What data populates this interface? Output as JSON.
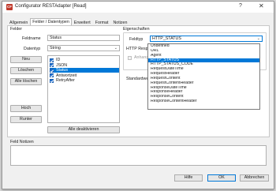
{
  "window": {
    "title": "Configurator RESTAdapter [Read]",
    "icon_label": "CF",
    "help_label": "?",
    "close_label": "✕"
  },
  "tabs": [
    "Allgemein",
    "Felder / Datentypen",
    "Erweitert",
    "Format",
    "Notizen"
  ],
  "active_tab": "Felder / Datentypen",
  "felder": {
    "group_label": "Felder",
    "feldname_label": "Feldname",
    "feldname_value": "Status",
    "datentyp_label": "Datentyp",
    "datentyp_value": "String",
    "buttons": {
      "neu": "Neu",
      "loeschen": "Löschen",
      "alle_loeschen": "Alle löschen",
      "hoch": "Hoch",
      "runter": "Runter",
      "alle_deaktivieren": "Alle deaktivieren"
    },
    "fields": [
      {
        "label": "ID",
        "checked": true,
        "selected": false
      },
      {
        "label": "JSON",
        "checked": true,
        "selected": false
      },
      {
        "label": "Status",
        "checked": true,
        "selected": true
      },
      {
        "label": "Antwortzeit",
        "checked": true,
        "selected": false
      },
      {
        "label": "RetryAfter",
        "checked": true,
        "selected": false
      }
    ]
  },
  "eigenschaften": {
    "group_label": "Eigenschaften",
    "feldtyp_label": "Feldtyp",
    "feldtyp_value": "HTTP_STATUS",
    "http_response_label": "HTTP Respo",
    "anhang_label": "Anhang",
    "standardwert_label": "Standardwert",
    "feldtyp_options": [
      "Undefined",
      "URL",
      "Agent",
      "HTTP_STATUS",
      "HTTP_STATUS_CODE",
      "RequestDateTime",
      "RequestHeader",
      "RequestContent",
      "RequestContentHeader",
      "ResponseDateTime",
      "ResponseHeader",
      "ResponseContent",
      "ResponseContentHeader"
    ],
    "feldtyp_selected_index": 3
  },
  "notes": {
    "label": "Feld Notizen",
    "value": ""
  },
  "footer": {
    "help": "Hilfe",
    "ok": "OK",
    "cancel": "Abbrechen"
  }
}
